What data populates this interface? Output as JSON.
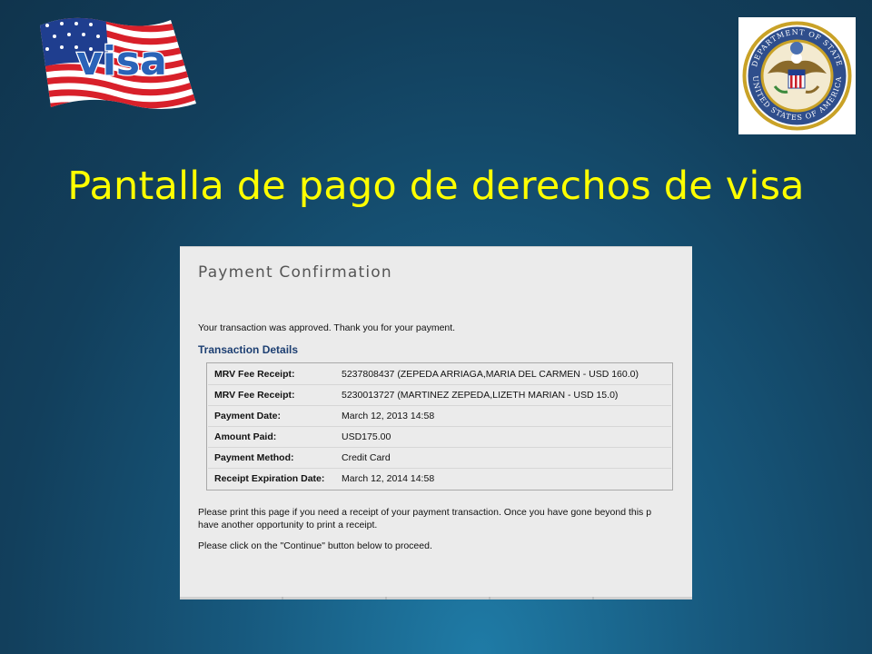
{
  "slide": {
    "title": "Pantalla de pago de derechos de visa",
    "visa_logo_text": "visa",
    "seal_text": "DEPARTMENT OF STATE · UNITED STATES OF AMERICA"
  },
  "payment": {
    "heading": "Payment Confirmation",
    "approved_message": "Your transaction was approved. Thank you for your payment.",
    "details_heading": "Transaction Details",
    "rows": [
      {
        "label": "MRV Fee Receipt:",
        "value": "5237808437 (ZEPEDA ARRIAGA,MARIA DEL CARMEN - USD 160.0)"
      },
      {
        "label": "MRV Fee Receipt:",
        "value": "5230013727 (MARTINEZ ZEPEDA,LIZETH MARIAN - USD 15.0)"
      },
      {
        "label": "Payment Date:",
        "value": "March 12, 2013 14:58"
      },
      {
        "label": "Amount Paid:",
        "value": "USD175.00"
      },
      {
        "label": "Payment Method:",
        "value": "Credit Card"
      },
      {
        "label": "Receipt Expiration Date:",
        "value": "March 12, 2014 14:58"
      }
    ],
    "print_notice_line1": "Please print this page if you need a receipt of your payment transaction. Once you have gone beyond this p",
    "print_notice_line2": "have another opportunity to print a receipt.",
    "continue_notice": "Please click on the \"Continue\" button below to proceed."
  },
  "colors": {
    "title": "#ffff00",
    "background": "#17597e",
    "details_heading": "#1d3f72"
  }
}
